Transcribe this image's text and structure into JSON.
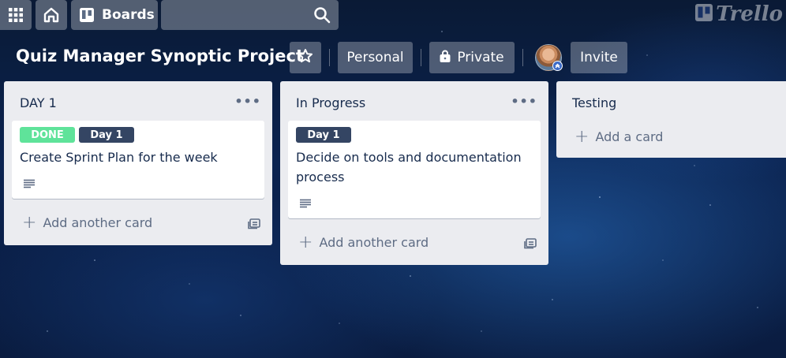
{
  "header": {
    "apps_icon": "grid-icon",
    "home_icon": "home-icon",
    "boards_label": "Boards",
    "boards_icon": "boards-icon",
    "search_placeholder": "",
    "search_icon": "search-icon",
    "logo_text": "Trello"
  },
  "board": {
    "title": "Quiz Manager Synoptic Project",
    "star_icon": "star-icon",
    "team_label": "Personal",
    "visibility_label": "Private",
    "visibility_icon": "lock-icon",
    "invite_label": "Invite"
  },
  "lists": [
    {
      "title": "DAY 1",
      "cards": [
        {
          "labels": [
            "DONE",
            "Day 1"
          ],
          "title": "Create Sprint Plan for the week",
          "has_description": true
        }
      ],
      "add_label": "Add another card"
    },
    {
      "title": "In Progress",
      "cards": [
        {
          "labels": [
            "Day 1"
          ],
          "title_lines": [
            "Decide on tools and documentation",
            "process"
          ],
          "has_description": true
        }
      ],
      "add_label": "Add another card"
    },
    {
      "title": "Testing",
      "cards": [],
      "add_label": "Add a card"
    }
  ],
  "colors": {
    "done_label": "#5fe39a",
    "day_label": "#344563",
    "list_bg": "#ebecf0",
    "text": "#172b4d"
  }
}
